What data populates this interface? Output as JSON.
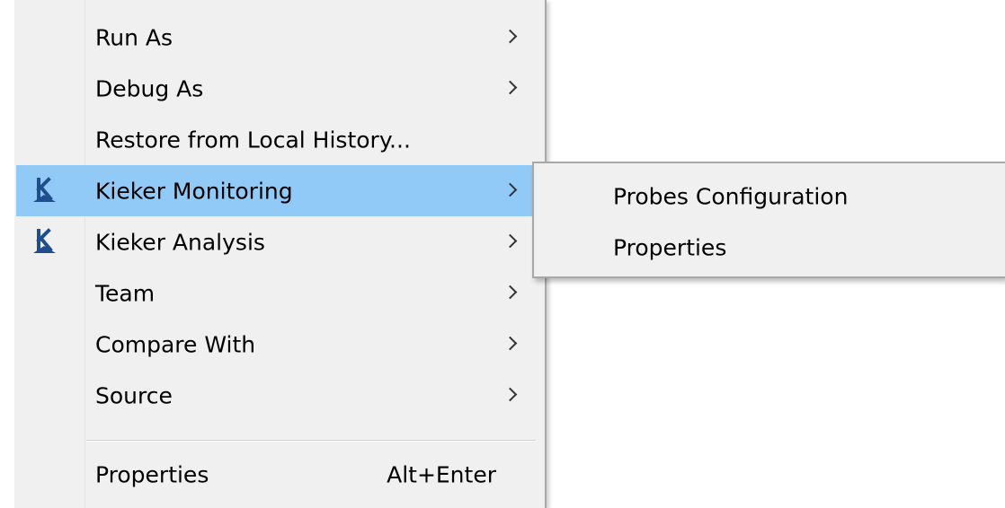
{
  "context_menu": {
    "items": [
      {
        "label": "Run As",
        "has_submenu": true
      },
      {
        "label": "Debug As",
        "has_submenu": true
      },
      {
        "label": "Restore from Local History...",
        "has_submenu": false
      },
      {
        "label": "Kieker Monitoring",
        "has_submenu": true,
        "icon": "kieker-icon",
        "highlighted": true
      },
      {
        "label": "Kieker Analysis",
        "has_submenu": true,
        "icon": "kieker-icon"
      },
      {
        "label": "Team",
        "has_submenu": true
      },
      {
        "label": "Compare With",
        "has_submenu": true
      },
      {
        "label": "Source",
        "has_submenu": true
      },
      {
        "label": "Properties",
        "shortcut": "Alt+Enter"
      }
    ]
  },
  "submenu": {
    "items": [
      {
        "label": "Probes Configuration"
      },
      {
        "label": "Properties"
      }
    ]
  },
  "colors": {
    "menu_background": "#f0f0f0",
    "highlight": "#91c9f7",
    "icon_blue": "#1f4e8c"
  }
}
